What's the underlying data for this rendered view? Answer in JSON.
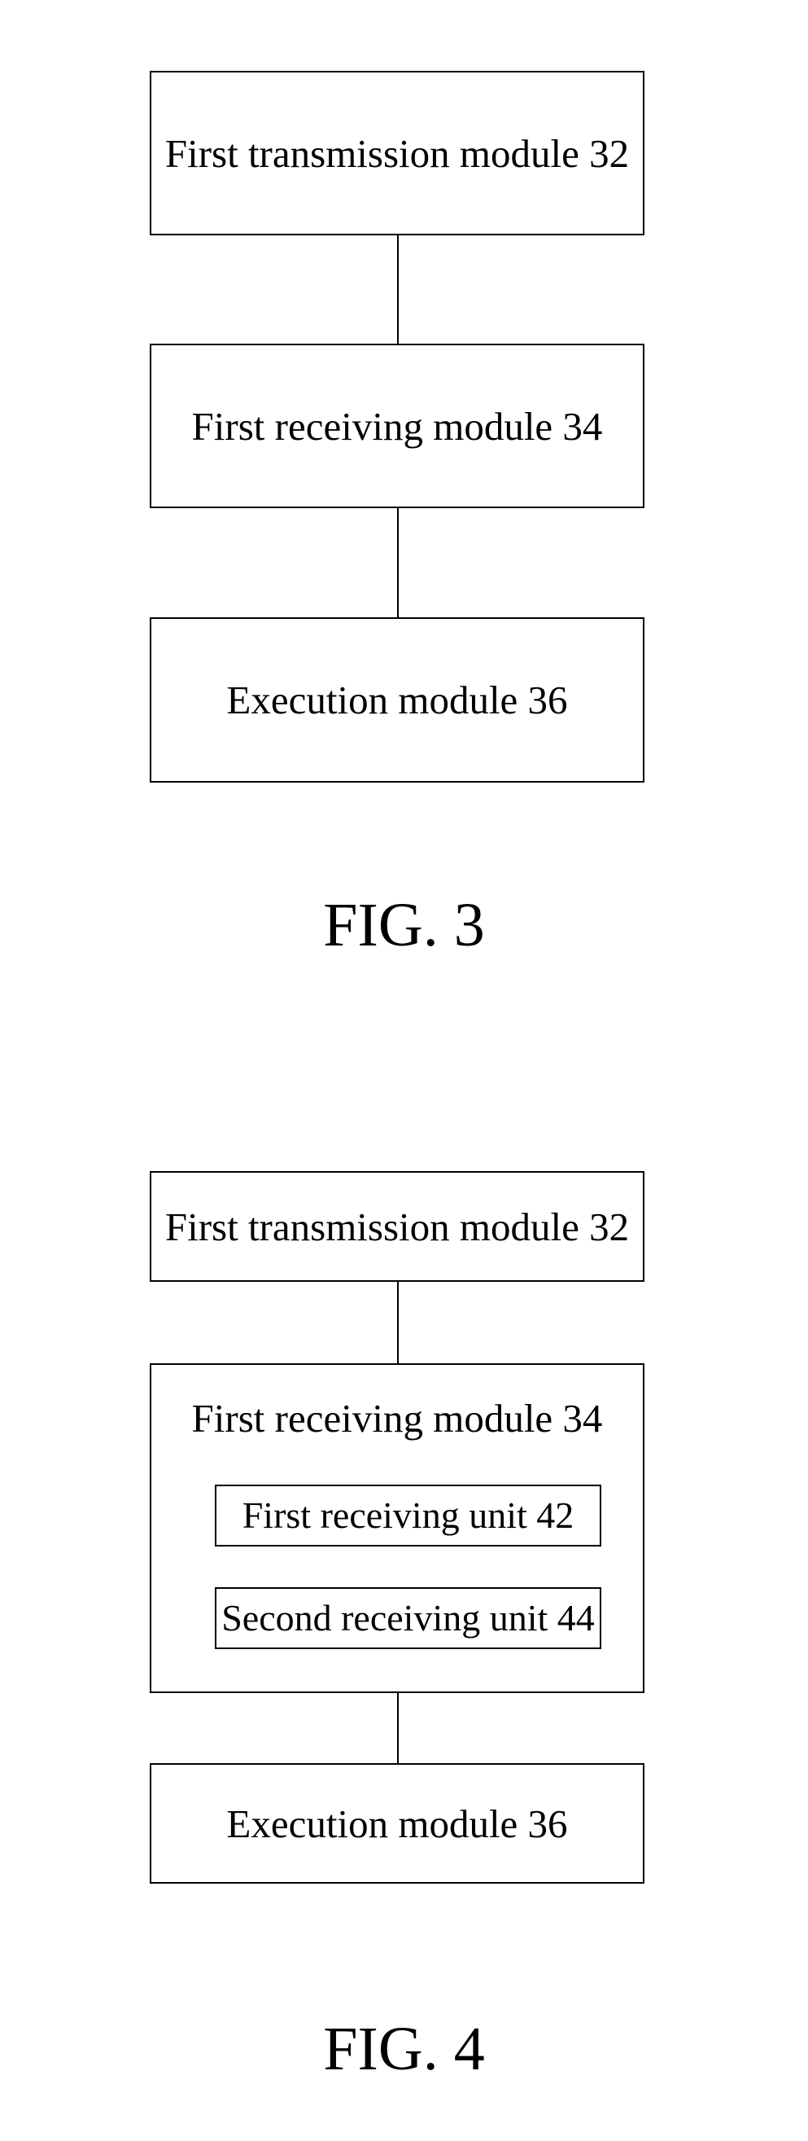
{
  "figures": [
    {
      "caption": "FIG. 3",
      "modules": [
        {
          "label": "First transmission module 32"
        },
        {
          "label": "First receiving module 34"
        },
        {
          "label": "Execution module 36"
        }
      ]
    },
    {
      "caption": "FIG. 4",
      "modules": [
        {
          "label": "First transmission module 32"
        },
        {
          "label": "First receiving module 34",
          "units": [
            {
              "label": "First receiving unit 42"
            },
            {
              "label": "Second receiving unit 44"
            }
          ]
        },
        {
          "label": "Execution module 36"
        }
      ]
    }
  ],
  "colors": {
    "line": "#000000",
    "background": "#ffffff"
  }
}
